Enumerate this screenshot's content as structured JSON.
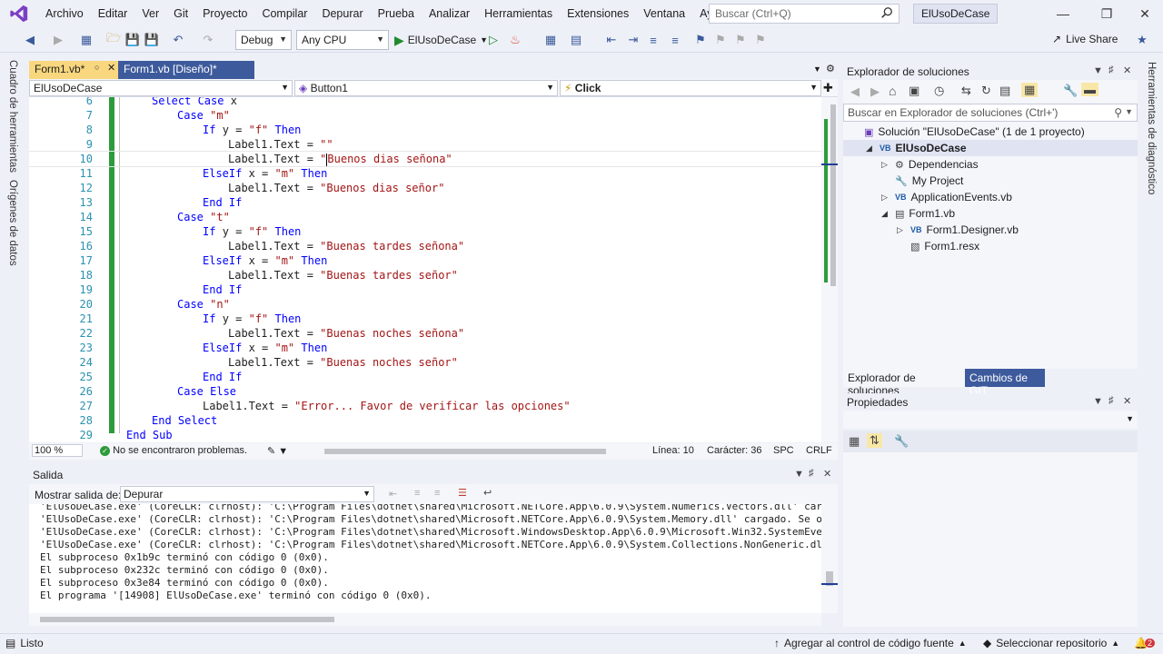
{
  "menu": {
    "items": [
      "Archivo",
      "Editar",
      "Ver",
      "Git",
      "Proyecto",
      "Compilar",
      "Depurar",
      "Prueba",
      "Analizar",
      "Herramientas",
      "Extensiones",
      "Ventana",
      "Ayuda"
    ],
    "search_placeholder": "Buscar (Ctrl+Q)",
    "solution_name": "ElUsoDeCase"
  },
  "toolbar": {
    "configuration": "Debug",
    "platform": "Any CPU",
    "run_target": "ElUsoDeCase",
    "live_share": "Live Share"
  },
  "left_strip": {
    "toolbox": "Cuadro de herramientas",
    "datasources": "Orígenes de datos"
  },
  "right_strip": {
    "diag": "Herramientas de diagnóstico"
  },
  "editor": {
    "tabs": [
      {
        "label": "Form1.vb*",
        "active": true
      },
      {
        "label": "Form1.vb [Diseño]*",
        "active": false
      }
    ],
    "nav": {
      "project": "ElUsoDeCase",
      "object": "Button1",
      "event": "Click"
    },
    "lines": [
      {
        "num": "6",
        "indent": 2,
        "tokens": [
          {
            "t": "Select Case ",
            "c": "kw"
          },
          {
            "t": "x",
            "c": "ident"
          }
        ]
      },
      {
        "num": "7",
        "indent": 3,
        "tokens": [
          {
            "t": "Case ",
            "c": "kw"
          },
          {
            "t": "\"m\"",
            "c": "str"
          }
        ]
      },
      {
        "num": "8",
        "indent": 4,
        "tokens": [
          {
            "t": "If ",
            "c": "kw"
          },
          {
            "t": "y = ",
            "c": "ident"
          },
          {
            "t": "\"f\"",
            "c": "str"
          },
          {
            "t": " Then",
            "c": "kw"
          }
        ]
      },
      {
        "num": "9",
        "indent": 5,
        "tokens": [
          {
            "t": "Label1.Text = ",
            "c": "ident"
          },
          {
            "t": "\"\"",
            "c": "str"
          }
        ]
      },
      {
        "num": "10",
        "indent": 5,
        "tokens": [
          {
            "t": "Label1.Text = ",
            "c": "ident"
          },
          {
            "t": "\"Buenos dias señona\"",
            "c": "str"
          }
        ]
      },
      {
        "num": "11",
        "indent": 4,
        "tokens": [
          {
            "t": "ElseIf ",
            "c": "kw"
          },
          {
            "t": "x = ",
            "c": "ident"
          },
          {
            "t": "\"m\"",
            "c": "str"
          },
          {
            "t": " Then",
            "c": "kw"
          }
        ]
      },
      {
        "num": "12",
        "indent": 5,
        "tokens": [
          {
            "t": "Label1.Text = ",
            "c": "ident"
          },
          {
            "t": "\"Buenos dias señor\"",
            "c": "str"
          }
        ]
      },
      {
        "num": "13",
        "indent": 4,
        "tokens": [
          {
            "t": "End If",
            "c": "kw"
          }
        ]
      },
      {
        "num": "14",
        "indent": 3,
        "tokens": [
          {
            "t": "Case ",
            "c": "kw"
          },
          {
            "t": "\"t\"",
            "c": "str"
          }
        ]
      },
      {
        "num": "15",
        "indent": 4,
        "tokens": [
          {
            "t": "If ",
            "c": "kw"
          },
          {
            "t": "y = ",
            "c": "ident"
          },
          {
            "t": "\"f\"",
            "c": "str"
          },
          {
            "t": " Then",
            "c": "kw"
          }
        ]
      },
      {
        "num": "16",
        "indent": 5,
        "tokens": [
          {
            "t": "Label1.Text = ",
            "c": "ident"
          },
          {
            "t": "\"Buenas tardes señona\"",
            "c": "str"
          }
        ]
      },
      {
        "num": "17",
        "indent": 4,
        "tokens": [
          {
            "t": "ElseIf ",
            "c": "kw"
          },
          {
            "t": "x = ",
            "c": "ident"
          },
          {
            "t": "\"m\"",
            "c": "str"
          },
          {
            "t": " Then",
            "c": "kw"
          }
        ]
      },
      {
        "num": "18",
        "indent": 5,
        "tokens": [
          {
            "t": "Label1.Text = ",
            "c": "ident"
          },
          {
            "t": "\"Buenas tardes señor\"",
            "c": "str"
          }
        ]
      },
      {
        "num": "19",
        "indent": 4,
        "tokens": [
          {
            "t": "End If",
            "c": "kw"
          }
        ]
      },
      {
        "num": "20",
        "indent": 3,
        "tokens": [
          {
            "t": "Case ",
            "c": "kw"
          },
          {
            "t": "\"n\"",
            "c": "str"
          }
        ]
      },
      {
        "num": "21",
        "indent": 4,
        "tokens": [
          {
            "t": "If ",
            "c": "kw"
          },
          {
            "t": "y = ",
            "c": "ident"
          },
          {
            "t": "\"f\"",
            "c": "str"
          },
          {
            "t": " Then",
            "c": "kw"
          }
        ]
      },
      {
        "num": "22",
        "indent": 5,
        "tokens": [
          {
            "t": "Label1.Text = ",
            "c": "ident"
          },
          {
            "t": "\"Buenas noches señona\"",
            "c": "str"
          }
        ]
      },
      {
        "num": "23",
        "indent": 4,
        "tokens": [
          {
            "t": "ElseIf ",
            "c": "kw"
          },
          {
            "t": "x = ",
            "c": "ident"
          },
          {
            "t": "\"m\"",
            "c": "str"
          },
          {
            "t": " Then",
            "c": "kw"
          }
        ]
      },
      {
        "num": "24",
        "indent": 5,
        "tokens": [
          {
            "t": "Label1.Text = ",
            "c": "ident"
          },
          {
            "t": "\"Buenas noches señor\"",
            "c": "str"
          }
        ]
      },
      {
        "num": "25",
        "indent": 4,
        "tokens": [
          {
            "t": "End If",
            "c": "kw"
          }
        ]
      },
      {
        "num": "26",
        "indent": 3,
        "tokens": [
          {
            "t": "Case Else",
            "c": "kw"
          }
        ]
      },
      {
        "num": "27",
        "indent": 4,
        "tokens": [
          {
            "t": "Label1.Text = ",
            "c": "ident"
          },
          {
            "t": "\"Error... Favor de verificar las opciones\"",
            "c": "str"
          }
        ]
      },
      {
        "num": "28",
        "indent": 2,
        "tokens": [
          {
            "t": "End Select",
            "c": "kw"
          }
        ]
      },
      {
        "num": "29",
        "indent": 1,
        "tokens": [
          {
            "t": "End Sub",
            "c": "kw"
          }
        ]
      }
    ],
    "status": {
      "zoom": "100 %",
      "problems": "No se encontraron problemas.",
      "line": "Línea: 10",
      "char": "Carácter: 36",
      "spc": "SPC",
      "crlf": "CRLF"
    }
  },
  "output": {
    "title": "Salida",
    "show_from_label": "Mostrar salida de:",
    "show_from_value": "Depurar",
    "lines": [
      "'ElUsoDeCase.exe' (CoreCLR: clrhost): 'C:\\Program Files\\dotnet\\shared\\Microsoft.NETCore.App\\6.0.9\\System.Numerics.Vectors.dll' carg",
      "'ElUsoDeCase.exe' (CoreCLR: clrhost): 'C:\\Program Files\\dotnet\\shared\\Microsoft.NETCore.App\\6.0.9\\System.Memory.dll' cargado. Se om",
      "'ElUsoDeCase.exe' (CoreCLR: clrhost): 'C:\\Program Files\\dotnet\\shared\\Microsoft.WindowsDesktop.App\\6.0.9\\Microsoft.Win32.SystemEven",
      "'ElUsoDeCase.exe' (CoreCLR: clrhost): 'C:\\Program Files\\dotnet\\shared\\Microsoft.NETCore.App\\6.0.9\\System.Collections.NonGeneric.dll",
      "El subproceso 0x1b9c terminó con código 0 (0x0).",
      "El subproceso 0x232c terminó con código 0 (0x0).",
      "El subproceso 0x3e84 terminó con código 0 (0x0).",
      "El programa '[14908] ElUsoDeCase.exe' terminó con código 0 (0x0)."
    ]
  },
  "solution_explorer": {
    "title": "Explorador de soluciones",
    "search_placeholder": "Buscar en Explorador de soluciones (Ctrl+')",
    "tree": [
      {
        "label": "Solución \"ElUsoDeCase\" (1 de 1 proyecto)",
        "depth": 0,
        "chevron": "",
        "icon": "solution-icon",
        "bold": false
      },
      {
        "label": "ElUsoDeCase",
        "depth": 1,
        "chevron": "◢",
        "icon": "vb-project-icon",
        "bold": true
      },
      {
        "label": "Dependencias",
        "depth": 2,
        "chevron": "▷",
        "icon": "dependencies-icon",
        "bold": false
      },
      {
        "label": "My Project",
        "depth": 2,
        "chevron": "",
        "icon": "wrench-icon",
        "bold": false
      },
      {
        "label": "ApplicationEvents.vb",
        "depth": 2,
        "chevron": "▷",
        "icon": "vb-file-icon",
        "bold": false
      },
      {
        "label": "Form1.vb",
        "depth": 2,
        "chevron": "◢",
        "icon": "form-icon",
        "bold": false
      },
      {
        "label": "Form1.Designer.vb",
        "depth": 3,
        "chevron": "▷",
        "icon": "vb-file-icon",
        "bold": false
      },
      {
        "label": "Form1.resx",
        "depth": 3,
        "chevron": "",
        "icon": "resx-icon",
        "bold": false
      }
    ],
    "tabs": [
      "Explorador de soluciones",
      "Cambios de GIT"
    ]
  },
  "properties": {
    "title": "Propiedades"
  },
  "statusbar": {
    "ready": "Listo",
    "source_control": "Agregar al control de código fuente",
    "repo": "Seleccionar repositorio",
    "notifications": "2"
  }
}
